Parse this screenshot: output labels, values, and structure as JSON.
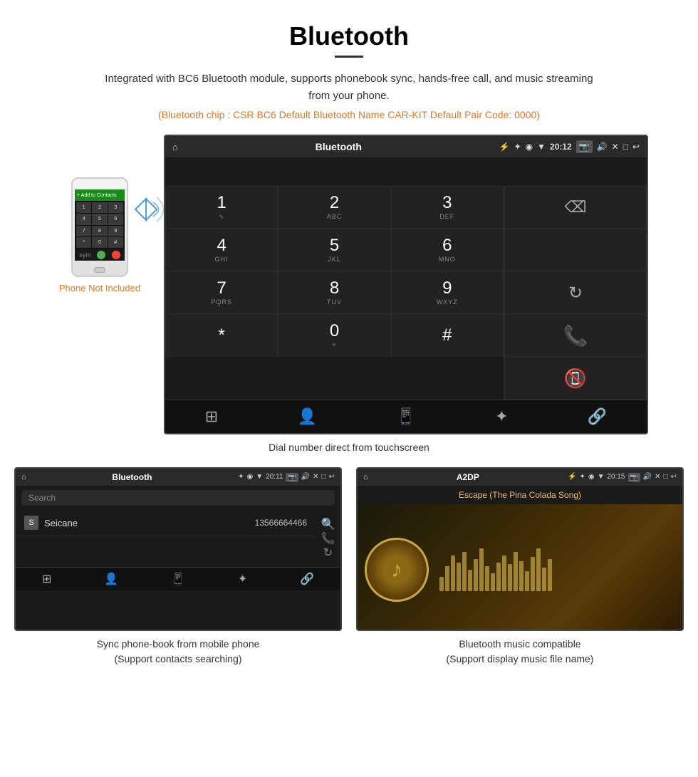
{
  "header": {
    "title": "Bluetooth",
    "subtitle": "Integrated with BC6 Bluetooth module, supports phonebook sync, hands-free call, and music streaming from your phone.",
    "specs": "(Bluetooth chip : CSR BC6    Default Bluetooth Name CAR-KIT    Default Pair Code: 0000)"
  },
  "main_screen": {
    "header": {
      "home_icon": "⌂",
      "title": "Bluetooth",
      "usb_icon": "⚡",
      "bt_icon": "✦",
      "location_icon": "◉",
      "wifi_icon": "▼",
      "time": "20:12",
      "camera_icon": "📷",
      "vol_icon": "🔊",
      "close_icon": "✕",
      "window_icon": "□",
      "back_icon": "↩"
    },
    "dialpad": {
      "keys": [
        {
          "num": "1",
          "sub": "∿"
        },
        {
          "num": "2",
          "sub": "ABC"
        },
        {
          "num": "3",
          "sub": "DEF"
        },
        {
          "num": "4",
          "sub": "GHI"
        },
        {
          "num": "5",
          "sub": "JKL"
        },
        {
          "num": "6",
          "sub": "MNO"
        },
        {
          "num": "7",
          "sub": "PQRS"
        },
        {
          "num": "8",
          "sub": "TUV"
        },
        {
          "num": "9",
          "sub": "WXYZ"
        },
        {
          "num": "*",
          "sub": ""
        },
        {
          "num": "0",
          "sub": "+"
        },
        {
          "num": "#",
          "sub": ""
        }
      ]
    },
    "caption": "Dial number direct from touchscreen"
  },
  "phonebook_screen": {
    "header": {
      "home_icon": "⌂",
      "title": "Bluetooth",
      "usb_icon": "⚡",
      "bt_icon": "✦",
      "location_icon": "◉",
      "wifi_icon": "▼",
      "time": "20:11",
      "camera_icon": "📷",
      "vol_icon": "🔊",
      "close_icon": "✕",
      "window_icon": "□",
      "back_icon": "↩"
    },
    "search_placeholder": "Search",
    "contacts": [
      {
        "letter": "S",
        "name": "Seicane",
        "number": "13566664466"
      }
    ],
    "caption_line1": "Sync phone-book from mobile phone",
    "caption_line2": "(Support contacts searching)"
  },
  "music_screen": {
    "header": {
      "home_icon": "⌂",
      "title": "A2DP",
      "usb_icon": "⚡",
      "bt_icon": "✦",
      "location_icon": "◉",
      "wifi_icon": "▼",
      "time": "20:15",
      "camera_icon": "📷",
      "vol_icon": "🔊",
      "close_icon": "✕",
      "window_icon": "□",
      "back_icon": "↩"
    },
    "song_title": "Escape (The Pina Colada Song)",
    "waveform_heights": [
      20,
      35,
      50,
      40,
      55,
      30,
      45,
      60,
      35,
      25,
      40,
      50,
      38,
      55,
      42,
      28,
      48,
      60,
      33,
      45
    ],
    "caption_line1": "Bluetooth music compatible",
    "caption_line2": "(Support display music file name)"
  },
  "phone_not_included": "Phone Not Included"
}
